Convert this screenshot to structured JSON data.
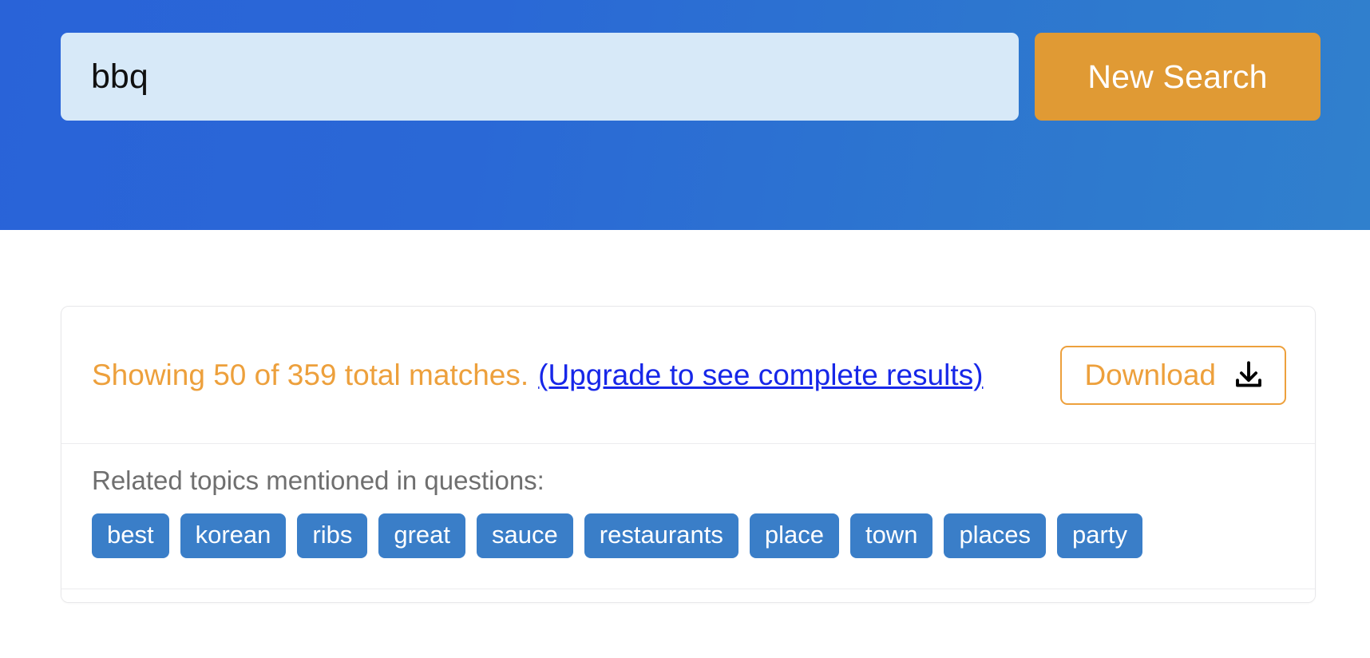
{
  "header": {
    "search": {
      "value": "bbq",
      "placeholder": "Enter a search term"
    },
    "new_search_label": "New Search",
    "colors": {
      "gradient_start": "#2963d8",
      "gradient_end": "#3080cd",
      "button_bg": "#e09a34",
      "input_bg": "#d7e9f8"
    }
  },
  "results": {
    "matches_text": "Showing 50 of 359 total matches.",
    "shown_count": 50,
    "total_count": 359,
    "upgrade_link_label": "(Upgrade to see complete results)",
    "download_label": "Download",
    "download_icon": "download-icon",
    "colors": {
      "matches_text": "#eda03c",
      "link": "#1727e8",
      "download_border": "#eda03c"
    }
  },
  "topics": {
    "heading": "Related topics mentioned in questions:",
    "tag_color": "#3a7ec8",
    "tags": [
      {
        "label": "best"
      },
      {
        "label": "korean"
      },
      {
        "label": "ribs"
      },
      {
        "label": "great"
      },
      {
        "label": "sauce"
      },
      {
        "label": "restaurants"
      },
      {
        "label": "place"
      },
      {
        "label": "town"
      },
      {
        "label": "places"
      },
      {
        "label": "party"
      }
    ]
  }
}
